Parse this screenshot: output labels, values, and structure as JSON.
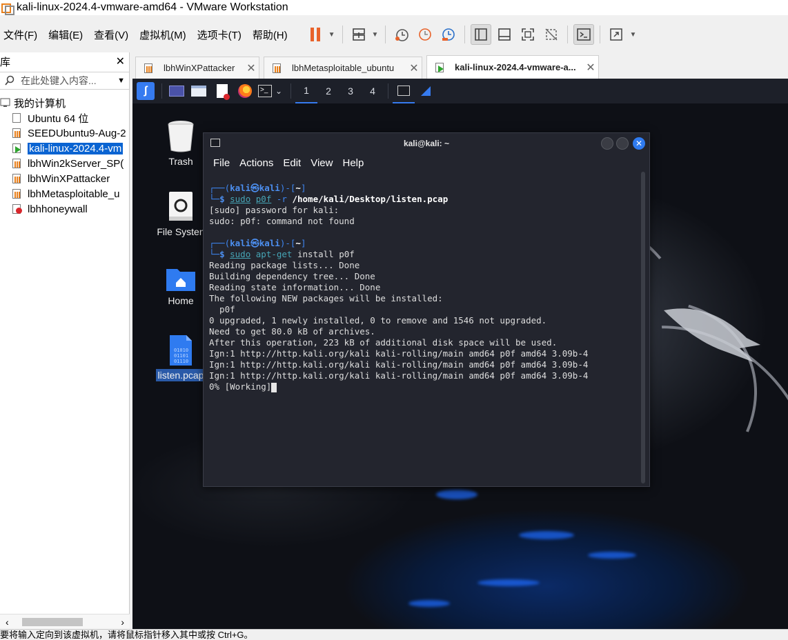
{
  "window": {
    "title": "kali-linux-2024.4-vmware-amd64 - VMware Workstation"
  },
  "menubar": {
    "items": [
      "文件(F)",
      "编辑(E)",
      "查看(V)",
      "虚拟机(M)",
      "选项卡(T)",
      "帮助(H)"
    ]
  },
  "library": {
    "title": "库",
    "search_placeholder": "在此处键入内容...",
    "root_label": "我的计算机",
    "vms": [
      {
        "label": "Ubuntu 64 位",
        "state": "off"
      },
      {
        "label": "SEEDUbuntu9-Aug-2",
        "state": "suspended"
      },
      {
        "label": "kali-linux-2024.4-vm",
        "state": "running"
      },
      {
        "label": "lbhWin2kServer_SP(",
        "state": "suspended"
      },
      {
        "label": "lbhWinXPattacker",
        "state": "suspended"
      },
      {
        "label": "lbhMetasploitable_u",
        "state": "suspended"
      },
      {
        "label": "lbhhoneywall",
        "state": "error"
      }
    ]
  },
  "tabs": [
    {
      "label": "lbhWinXPattacker",
      "active": false
    },
    {
      "label": "lbhMetasploitable_ubuntu",
      "active": false
    },
    {
      "label": "kali-linux-2024.4-vmware-a...",
      "active": true
    }
  ],
  "kali_panel": {
    "workspaces": [
      "1",
      "2",
      "3",
      "4"
    ]
  },
  "desktop_icons": [
    {
      "label": "Trash",
      "icon": "trash-icon"
    },
    {
      "label": "File Systen",
      "icon": "drive-icon"
    },
    {
      "label": "Home",
      "icon": "home-folder-icon"
    },
    {
      "label": "listen.pcap",
      "icon": "binary-file-icon",
      "selected": true
    }
  ],
  "terminal": {
    "title": "kali@kali: ~",
    "menu": [
      "File",
      "Actions",
      "Edit",
      "View",
      "Help"
    ],
    "prompt_user": "kali",
    "prompt_host": "kali",
    "prompt_dir": "~",
    "cmd1": {
      "sudo": "sudo",
      "prog": "p0f",
      "flag": "-r",
      "arg": "/home/kali/Desktop/listen.pcap"
    },
    "output1": [
      "[sudo] password for kali:",
      "sudo: p0f: command not found"
    ],
    "cmd2": {
      "sudo": "sudo",
      "prog": "apt-get",
      "rest": "install p0f"
    },
    "output2": [
      "Reading package lists... Done",
      "Building dependency tree... Done",
      "Reading state information... Done",
      "The following NEW packages will be installed:",
      "  p0f",
      "0 upgraded, 1 newly installed, 0 to remove and 1546 not upgraded.",
      "Need to get 80.0 kB of archives.",
      "After this operation, 223 kB of additional disk space will be used.",
      "Ign:1 http://http.kali.org/kali kali-rolling/main amd64 p0f amd64 3.09b-4",
      "Ign:1 http://http.kali.org/kali kali-rolling/main amd64 p0f amd64 3.09b-4",
      "Ign:1 http://http.kali.org/kali kali-rolling/main amd64 p0f amd64 3.09b-4"
    ],
    "progress_line": "0% [Working]"
  },
  "statusbar": {
    "text": "要将输入定向到该虚拟机，请将鼠标指针移入其中或按 Ctrl+G。"
  },
  "colors": {
    "accent": "#0a64d2",
    "kali_blue": "#367bf0",
    "terminal_bg": "#23252e"
  }
}
